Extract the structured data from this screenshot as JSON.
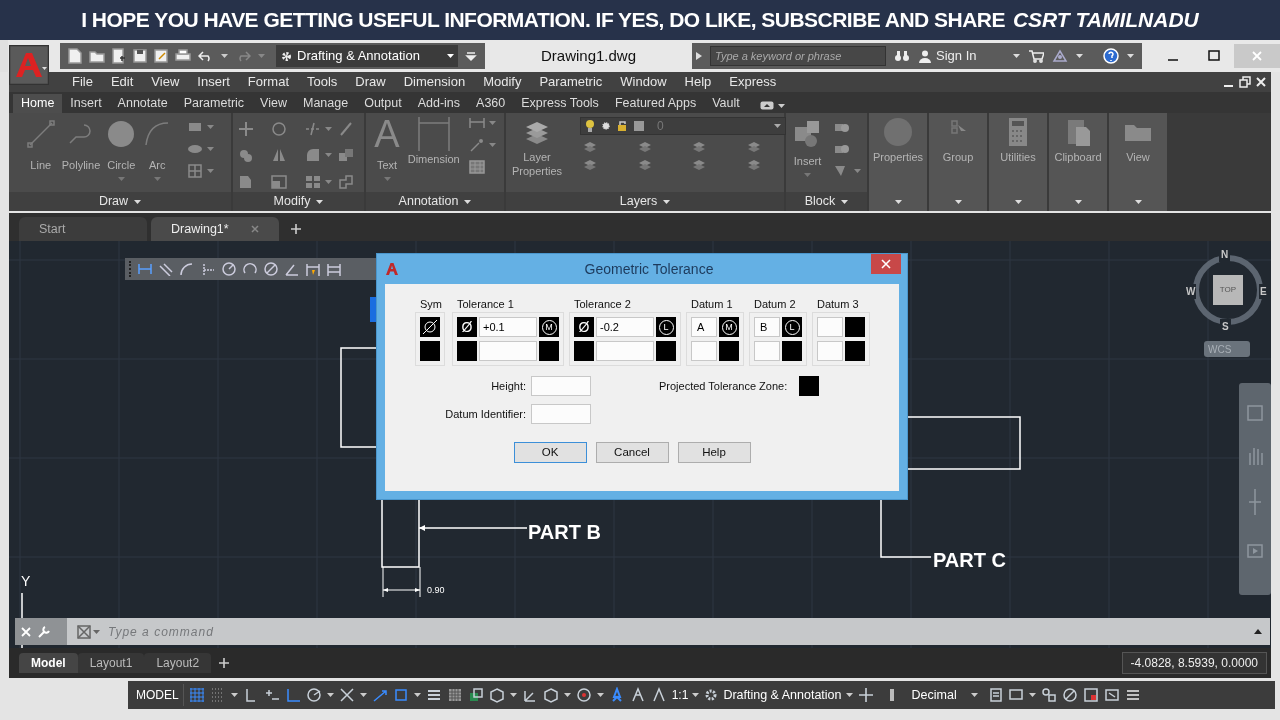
{
  "banner": {
    "text": "I HOPE YOU HAVE GETTING USEFUL INFORMATION. IF YES, DO LIKE, SUBSCRIBE AND SHARE",
    "channel": "CSRT TAMILNADU"
  },
  "title_bar": {
    "workspace": "Drafting & Annotation",
    "title": "Drawing1.dwg",
    "search": {
      "placeholder": "Type a keyword or phrase"
    },
    "sign_in": "Sign In"
  },
  "menu_bar": [
    "File",
    "Edit",
    "View",
    "Insert",
    "Format",
    "Tools",
    "Draw",
    "Dimension",
    "Modify",
    "Parametric",
    "Window",
    "Help",
    "Express"
  ],
  "ribbon_tabs": [
    {
      "label": "Home",
      "selected": true
    },
    {
      "label": "Insert",
      "selected": false
    },
    {
      "label": "Annotate",
      "selected": false
    },
    {
      "label": "Parametric",
      "selected": false
    },
    {
      "label": "View",
      "selected": false
    },
    {
      "label": "Manage",
      "selected": false
    },
    {
      "label": "Output",
      "selected": false
    },
    {
      "label": "Add-ins",
      "selected": false
    },
    {
      "label": "A360",
      "selected": false
    },
    {
      "label": "Express Tools",
      "selected": false
    },
    {
      "label": "Featured Apps",
      "selected": false
    },
    {
      "label": "Vault",
      "selected": false
    }
  ],
  "ribbon_panels": [
    {
      "kind": "draw",
      "title": "Draw",
      "tools": [
        "Line",
        "Polyline",
        "Circle",
        "Arc"
      ]
    },
    {
      "kind": "modify",
      "title": "Modify"
    },
    {
      "kind": "annotation",
      "title": "Annotation",
      "glyph": "A",
      "tools": [
        "Text",
        "Dimension"
      ]
    },
    {
      "kind": "layers",
      "title": "Layers",
      "layer": "0",
      "tools": [
        "Layer Properties"
      ]
    },
    {
      "kind": "block",
      "title": "Block",
      "tools": [
        "Insert"
      ]
    },
    {
      "kind": "collapsed",
      "title": "Properties"
    },
    {
      "kind": "collapsed",
      "title": "Group"
    },
    {
      "kind": "collapsed",
      "title": "Utilities"
    },
    {
      "kind": "collapsed",
      "title": "Clipboard"
    },
    {
      "kind": "collapsed",
      "title": "View"
    }
  ],
  "file_tabs": [
    {
      "label": "Start",
      "selected": false
    },
    {
      "label": "Drawing1*",
      "selected": true
    }
  ],
  "drawing": {
    "labels": [
      "PART B",
      "PART C"
    ],
    "dimension": "0.90",
    "axis": "Y",
    "viewcube": {
      "face": "TOP",
      "north": "N",
      "east": "E",
      "south": "S",
      "west": "W"
    },
    "ucs_menu": "WCS"
  },
  "dialog": {
    "title": "Geometric Tolerance",
    "groups": [
      {
        "label": "Sym",
        "rows": [
          [
            {
              "kind": "symbol"
            }
          ],
          [
            {
              "kind": "box"
            }
          ]
        ]
      },
      {
        "label": "Tolerance 1",
        "rows": [
          [
            {
              "kind": "box",
              "glyph": "Ø"
            },
            {
              "kind": "field",
              "value": "+0.1"
            },
            {
              "kind": "condition",
              "letter": "M"
            }
          ],
          [
            {
              "kind": "box"
            },
            {
              "kind": "field"
            },
            {
              "kind": "box"
            }
          ]
        ]
      },
      {
        "label": "Tolerance 2",
        "rows": [
          [
            {
              "kind": "box",
              "glyph": "Ø"
            },
            {
              "kind": "field",
              "value": "-0.2"
            },
            {
              "kind": "condition",
              "letter": "L"
            }
          ],
          [
            {
              "kind": "box"
            },
            {
              "kind": "field"
            },
            {
              "kind": "box"
            }
          ]
        ]
      },
      {
        "label": "Datum 1",
        "rows": [
          [
            {
              "kind": "small_field",
              "value": "A"
            },
            {
              "kind": "condition",
              "letter": "M"
            }
          ],
          [
            {
              "kind": "small_field"
            },
            {
              "kind": "box"
            }
          ]
        ]
      },
      {
        "label": "Datum 2",
        "rows": [
          [
            {
              "kind": "small_field",
              "value": "B"
            },
            {
              "kind": "condition",
              "letter": "L"
            }
          ],
          [
            {
              "kind": "small_field"
            },
            {
              "kind": "box"
            }
          ]
        ]
      },
      {
        "label": "Datum 3",
        "rows": [
          [
            {
              "kind": "small_field"
            },
            {
              "kind": "box"
            }
          ],
          [
            {
              "kind": "small_field"
            },
            {
              "kind": "box"
            }
          ]
        ]
      }
    ],
    "height_label": "Height:",
    "datum_identifier_label": "Datum Identifier:",
    "projected_zone_label": "Projected Tolerance Zone:",
    "buttons": [
      {
        "label": "OK",
        "default": true
      },
      {
        "label": "Cancel",
        "default": false
      },
      {
        "label": "Help",
        "default": false
      }
    ]
  },
  "command_line": {
    "placeholder": "Type a command"
  },
  "layout_tabs": [
    {
      "label": "Model",
      "selected": true
    },
    {
      "label": "Layout1",
      "selected": false
    },
    {
      "label": "Layout2",
      "selected": false
    }
  ],
  "coordinates": "-4.0828, 8.5939, 0.0000",
  "status_bar": {
    "space": "MODEL",
    "scale": "1:1",
    "workspace": "Drafting & Annotation",
    "units": "Decimal"
  }
}
